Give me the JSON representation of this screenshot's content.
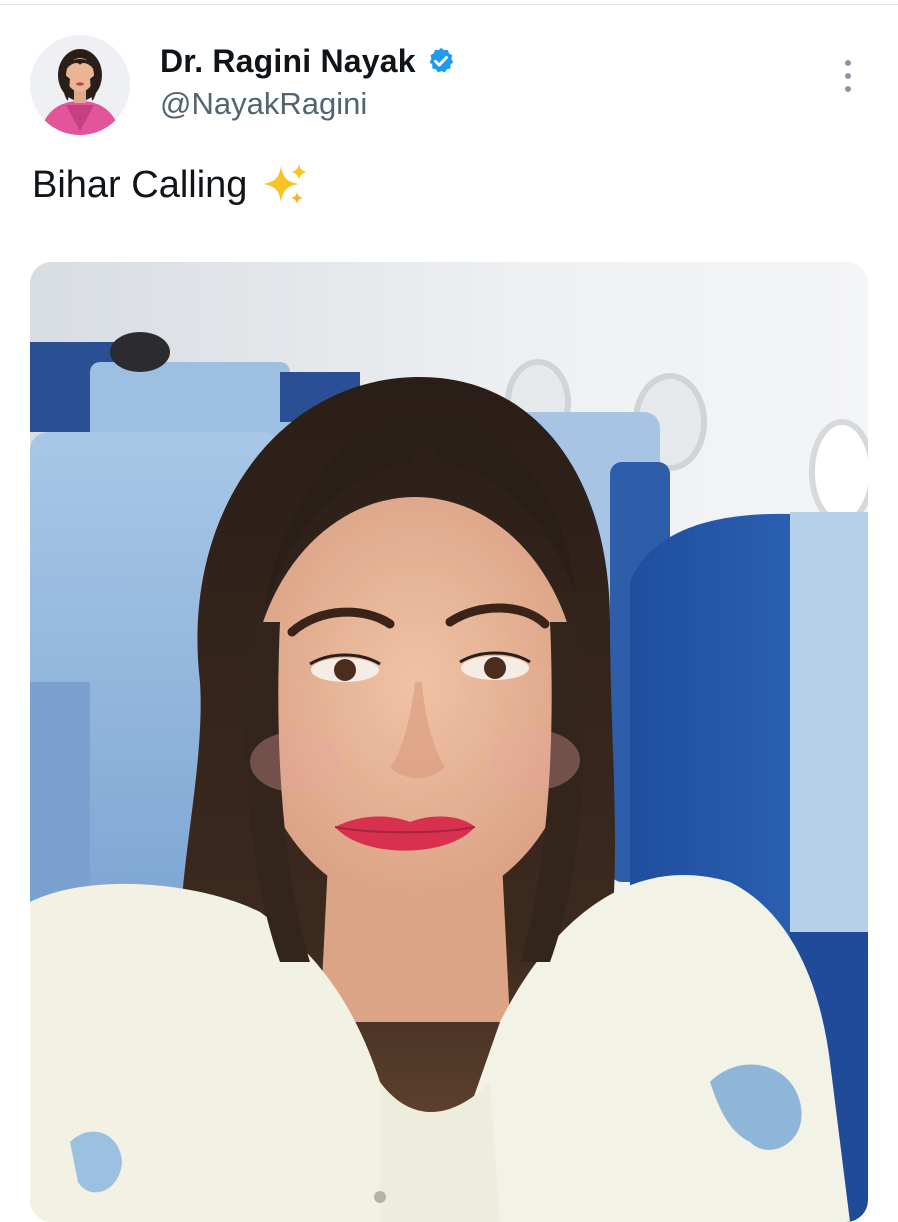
{
  "tweet": {
    "author": {
      "display_name": "Dr. Ragini Nayak",
      "handle": "@NayakRagini",
      "verified": true
    },
    "text": "Bihar Calling",
    "emoji": "sparkles-icon"
  },
  "colors": {
    "verified_blue": "#1d9bf0",
    "handle_gray": "#536471",
    "text_dark": "#0f1419",
    "seat_blue": "#2f5fae"
  }
}
